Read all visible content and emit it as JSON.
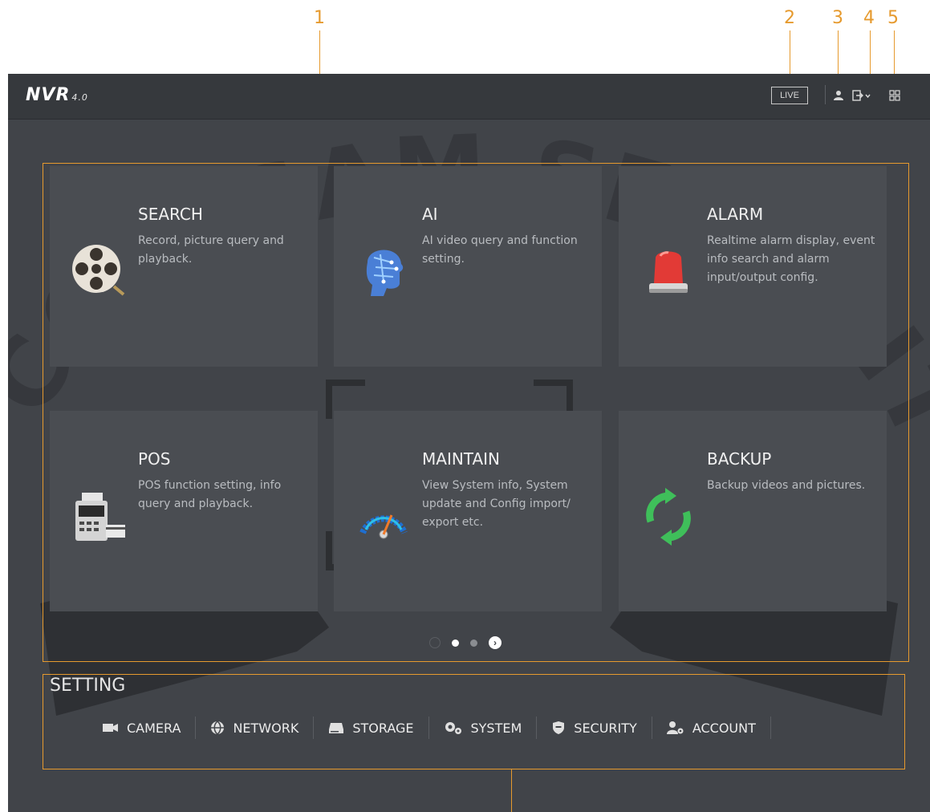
{
  "callouts": [
    "1",
    "2",
    "3",
    "4",
    "5"
  ],
  "topbar": {
    "logo": "NVR",
    "version": "4.0",
    "live_label": "LIVE",
    "icons": [
      "user-icon",
      "logout-icon",
      "grid-icon"
    ]
  },
  "watermark": "COLLSAM SECURITY",
  "tiles": [
    {
      "title": "SEARCH",
      "desc": "Record, picture query and playback.",
      "icon": "film-reel-icon"
    },
    {
      "title": "AI",
      "desc": "AI video query and function setting.",
      "icon": "ai-head-icon"
    },
    {
      "title": "ALARM",
      "desc": "Realtime alarm display, event info search and alarm input/output config.",
      "icon": "alarm-light-icon"
    },
    {
      "title": "POS",
      "desc": "POS function setting, info query and playback.",
      "icon": "pos-terminal-icon"
    },
    {
      "title": "MAINTAIN",
      "desc": "View System info, System update and Config import/ export etc.",
      "icon": "gauge-icon"
    },
    {
      "title": "BACKUP",
      "desc": "Backup videos and pictures.",
      "icon": "sync-icon"
    }
  ],
  "pager": {
    "pages": 2,
    "current": 1
  },
  "setting": {
    "title": "SETTING",
    "items": [
      {
        "label": "CAMERA",
        "icon": "camera-icon"
      },
      {
        "label": "NETWORK",
        "icon": "network-icon"
      },
      {
        "label": "STORAGE",
        "icon": "storage-icon"
      },
      {
        "label": "SYSTEM",
        "icon": "system-gears-icon"
      },
      {
        "label": "SECURITY",
        "icon": "shield-icon"
      },
      {
        "label": "ACCOUNT",
        "icon": "account-icon"
      }
    ]
  },
  "colors": {
    "accent": "#e69a2e",
    "screen_bg": "#414449",
    "tile_bg": "#4a4d52"
  }
}
